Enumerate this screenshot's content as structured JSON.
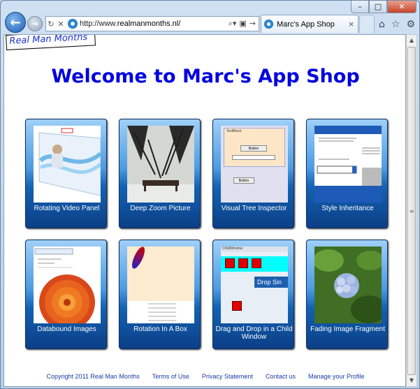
{
  "browser": {
    "url_prefix": "http://www.",
    "url_host": "realmanmonths.nl/",
    "tab_title": "Marc's App Shop",
    "tab_close": "×",
    "caption": {
      "minimize": "–",
      "maximize": "□",
      "close": "✕"
    },
    "icons": [
      "back-icon",
      "forward-icon",
      "refresh-icon",
      "stop-icon",
      "search-icon",
      "compatibility-icon",
      "go-icon",
      "home-icon",
      "favorites-icon",
      "tools-icon"
    ]
  },
  "page": {
    "logo": "Real Man Months",
    "heading": "Welcome to Marc's App Shop",
    "apps": [
      {
        "label": "Rotating Video Panel"
      },
      {
        "label": "Deep Zoom Picture"
      },
      {
        "label": "Visual Tree Inspector"
      },
      {
        "label": "Style Inheritance"
      },
      {
        "label": "Databound Images"
      },
      {
        "label": "Rotation In A Box"
      },
      {
        "label": "Drag and Drop in a Child Window"
      },
      {
        "label": "Fading Image Fragment"
      }
    ],
    "thumb_text": {
      "textblock": "TextBlock",
      "button": "Button",
      "child_window": "ChildWindow",
      "drop_sign": "Drop Sin"
    },
    "footer": {
      "copyright": "Copyright 2011 Real Man Months",
      "terms": "Terms of Use",
      "privacy": "Privacy Statement",
      "contact": "Contact us",
      "profile": "Manage your Profile"
    }
  },
  "colors": {
    "heading": "#0000e0",
    "logo": "#1a2fd0",
    "tile_top": "#9fd0f8",
    "tile_bottom": "#0b3f86",
    "footer_link": "#1a3aa8"
  }
}
